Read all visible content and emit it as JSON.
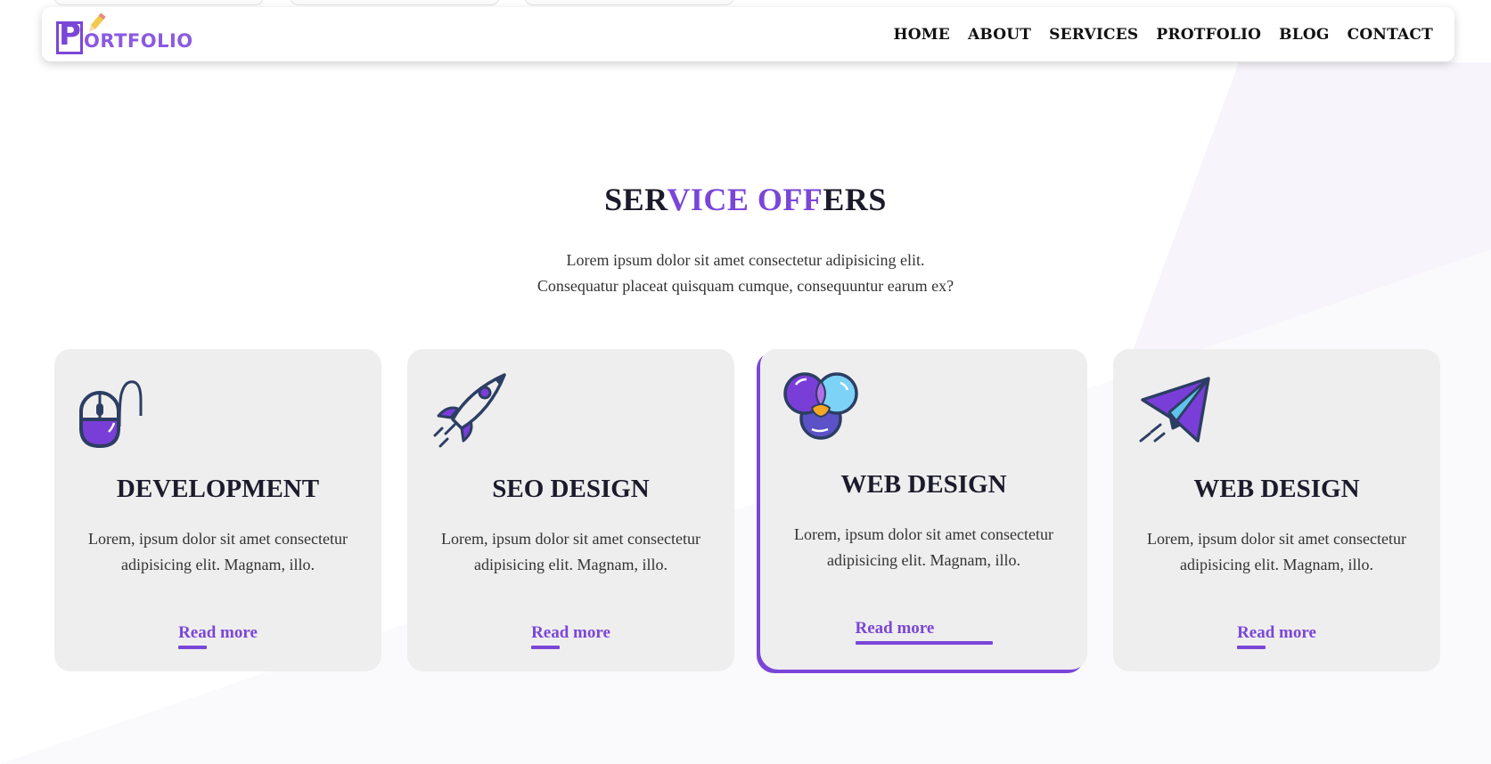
{
  "brand": {
    "logo_letter": "P",
    "logo_text": "ORTFOLIO",
    "accent_color": "#7a46d8"
  },
  "nav": {
    "items": [
      "HOME",
      "ABOUT",
      "SERVICES",
      "PROTFOLIO",
      "BLOG",
      "CONTACT"
    ]
  },
  "section": {
    "title_part1": "SER",
    "title_part2": "VICE OFF",
    "title_part3": "ERS",
    "subtitle_line1": "Lorem ipsum dolor sit amet consectetur adipisicing elit.",
    "subtitle_line2": "Consequatur placeat quisquam cumque, consequuntur earum ex?"
  },
  "cards": [
    {
      "icon": "mouse-icon",
      "title": "DEVELOPMENT",
      "text": "Lorem, ipsum dolor sit amet consectetur adipisicing elit. Magnam, illo.",
      "link": "Read more"
    },
    {
      "icon": "rocket-icon",
      "title": "SEO DESIGN",
      "text": "Lorem, ipsum dolor sit amet consectetur adipisicing elit. Magnam, illo.",
      "link": "Read more"
    },
    {
      "icon": "color-circles-icon",
      "title": "WEB DESIGN",
      "text": "Lorem, ipsum dolor sit amet consectetur adipisicing elit. Magnam, illo.",
      "link": "Read more"
    },
    {
      "icon": "paper-plane-icon",
      "title": "WEB DESIGN",
      "text": "Lorem, ipsum dolor sit amet consectetur adipisicing elit. Magnam, illo.",
      "link": "Read more"
    }
  ]
}
